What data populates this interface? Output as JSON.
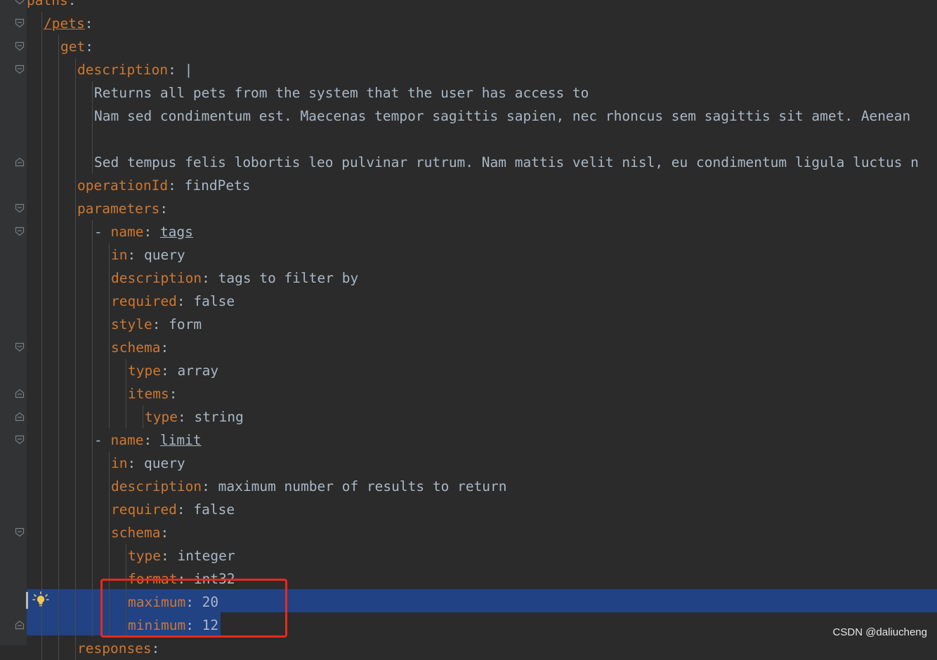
{
  "editor": {
    "lines": [
      {
        "indent": 0,
        "parts": [
          {
            "t": "paths",
            "c": "key"
          },
          {
            "t": ":",
            "c": "punc"
          }
        ]
      },
      {
        "indent": 1,
        "parts": [
          {
            "t": "/pets",
            "c": "refkey"
          },
          {
            "t": ":",
            "c": "punc"
          }
        ]
      },
      {
        "indent": 2,
        "parts": [
          {
            "t": "get",
            "c": "key"
          },
          {
            "t": ":",
            "c": "punc"
          }
        ]
      },
      {
        "indent": 3,
        "parts": [
          {
            "t": "description",
            "c": "key"
          },
          {
            "t": ": |",
            "c": "punc"
          }
        ]
      },
      {
        "indent": 4,
        "parts": [
          {
            "t": "Returns all pets from the system that the user has access to",
            "c": "val"
          }
        ]
      },
      {
        "indent": 4,
        "parts": [
          {
            "t": "Nam sed condimentum est. Maecenas tempor sagittis sapien, nec rhoncus sem sagittis sit amet. Aenean",
            "c": "val"
          }
        ]
      },
      {
        "indent": 4,
        "parts": [
          {
            "t": "",
            "c": "val"
          }
        ]
      },
      {
        "indent": 4,
        "parts": [
          {
            "t": "Sed tempus felis lobortis leo pulvinar rutrum. Nam mattis velit nisl, eu condimentum ligula luctus n",
            "c": "val"
          }
        ]
      },
      {
        "indent": 3,
        "parts": [
          {
            "t": "operationId",
            "c": "key"
          },
          {
            "t": ": ",
            "c": "punc"
          },
          {
            "t": "findPets",
            "c": "val"
          }
        ]
      },
      {
        "indent": 3,
        "parts": [
          {
            "t": "parameters",
            "c": "key"
          },
          {
            "t": ":",
            "c": "punc"
          }
        ]
      },
      {
        "indent": 4,
        "parts": [
          {
            "t": "- ",
            "c": "punc"
          },
          {
            "t": "name",
            "c": "key"
          },
          {
            "t": ": ",
            "c": "punc"
          },
          {
            "t": "tags",
            "c": "ref"
          }
        ]
      },
      {
        "indent": 5,
        "parts": [
          {
            "t": "in",
            "c": "key"
          },
          {
            "t": ": ",
            "c": "punc"
          },
          {
            "t": "query",
            "c": "val"
          }
        ]
      },
      {
        "indent": 5,
        "parts": [
          {
            "t": "description",
            "c": "key"
          },
          {
            "t": ": ",
            "c": "punc"
          },
          {
            "t": "tags to filter by",
            "c": "val"
          }
        ]
      },
      {
        "indent": 5,
        "parts": [
          {
            "t": "required",
            "c": "key"
          },
          {
            "t": ": ",
            "c": "punc"
          },
          {
            "t": "false",
            "c": "val"
          }
        ]
      },
      {
        "indent": 5,
        "parts": [
          {
            "t": "style",
            "c": "key"
          },
          {
            "t": ": ",
            "c": "punc"
          },
          {
            "t": "form",
            "c": "val"
          }
        ]
      },
      {
        "indent": 5,
        "parts": [
          {
            "t": "schema",
            "c": "key"
          },
          {
            "t": ":",
            "c": "punc"
          }
        ]
      },
      {
        "indent": 6,
        "parts": [
          {
            "t": "type",
            "c": "key"
          },
          {
            "t": ": ",
            "c": "punc"
          },
          {
            "t": "array",
            "c": "val"
          }
        ]
      },
      {
        "indent": 6,
        "parts": [
          {
            "t": "items",
            "c": "key"
          },
          {
            "t": ":",
            "c": "punc"
          }
        ]
      },
      {
        "indent": 7,
        "parts": [
          {
            "t": "type",
            "c": "key"
          },
          {
            "t": ": ",
            "c": "punc"
          },
          {
            "t": "string",
            "c": "val"
          }
        ]
      },
      {
        "indent": 4,
        "parts": [
          {
            "t": "- ",
            "c": "punc"
          },
          {
            "t": "name",
            "c": "key"
          },
          {
            "t": ": ",
            "c": "punc"
          },
          {
            "t": "limit",
            "c": "ref"
          }
        ]
      },
      {
        "indent": 5,
        "parts": [
          {
            "t": "in",
            "c": "key"
          },
          {
            "t": ": ",
            "c": "punc"
          },
          {
            "t": "query",
            "c": "val"
          }
        ]
      },
      {
        "indent": 5,
        "parts": [
          {
            "t": "description",
            "c": "key"
          },
          {
            "t": ": ",
            "c": "punc"
          },
          {
            "t": "maximum number of results to return",
            "c": "val"
          }
        ]
      },
      {
        "indent": 5,
        "parts": [
          {
            "t": "required",
            "c": "key"
          },
          {
            "t": ": ",
            "c": "punc"
          },
          {
            "t": "false",
            "c": "val"
          }
        ]
      },
      {
        "indent": 5,
        "parts": [
          {
            "t": "schema",
            "c": "key"
          },
          {
            "t": ":",
            "c": "punc"
          }
        ]
      },
      {
        "indent": 6,
        "parts": [
          {
            "t": "type",
            "c": "key"
          },
          {
            "t": ": ",
            "c": "punc"
          },
          {
            "t": "integer",
            "c": "val"
          }
        ]
      },
      {
        "indent": 6,
        "parts": [
          {
            "t": "format",
            "c": "key"
          },
          {
            "t": ": ",
            "c": "punc"
          },
          {
            "t": "int32",
            "c": "val"
          }
        ]
      },
      {
        "indent": 6,
        "parts": [
          {
            "t": "maximum",
            "c": "key"
          },
          {
            "t": ": ",
            "c": "punc"
          },
          {
            "t": "20",
            "c": "val"
          }
        ]
      },
      {
        "indent": 6,
        "parts": [
          {
            "t": "minimum",
            "c": "key"
          },
          {
            "t": ": ",
            "c": "punc"
          },
          {
            "t": "12",
            "c": "val"
          }
        ]
      },
      {
        "indent": 3,
        "parts": [
          {
            "t": "responses",
            "c": "key"
          },
          {
            "t": ":",
            "c": "punc"
          }
        ]
      }
    ],
    "fold_markers": [
      {
        "line": 0,
        "kind": "open"
      },
      {
        "line": 1,
        "kind": "open"
      },
      {
        "line": 2,
        "kind": "open"
      },
      {
        "line": 3,
        "kind": "open"
      },
      {
        "line": 7,
        "kind": "close"
      },
      {
        "line": 9,
        "kind": "open"
      },
      {
        "line": 10,
        "kind": "open"
      },
      {
        "line": 15,
        "kind": "open"
      },
      {
        "line": 17,
        "kind": "close"
      },
      {
        "line": 18,
        "kind": "close"
      },
      {
        "line": 19,
        "kind": "open"
      },
      {
        "line": 23,
        "kind": "open"
      },
      {
        "line": 27,
        "kind": "close"
      }
    ],
    "colors": {
      "background": "#2b2b2b",
      "key": "#cc7832",
      "value": "#a9b7c6",
      "selection": "#214283",
      "highlight_box": "#e8291c"
    }
  },
  "intention_icon": "lightbulb-icon",
  "watermark": "CSDN @daliucheng"
}
